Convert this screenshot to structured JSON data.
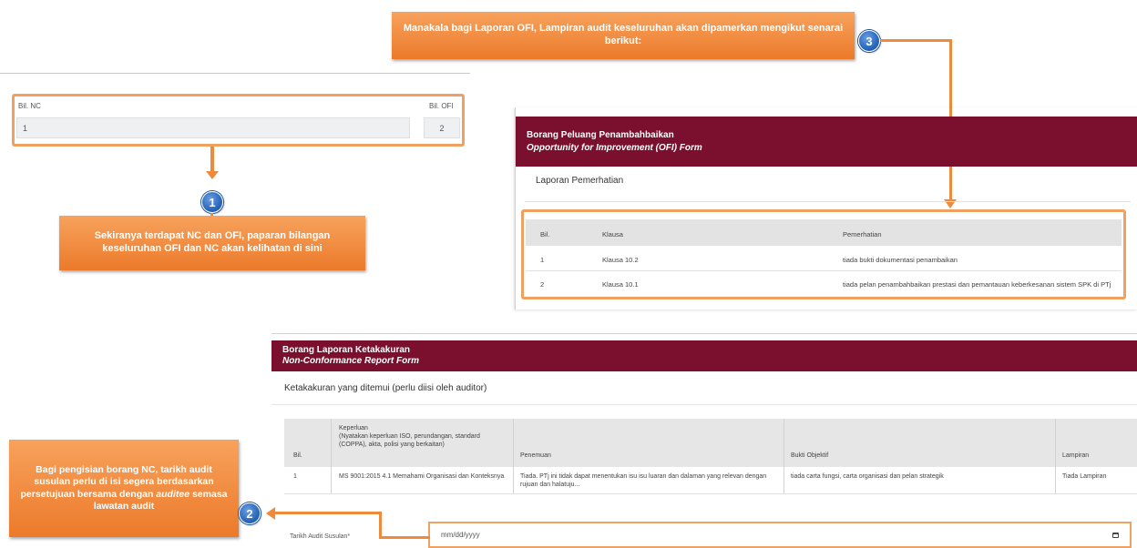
{
  "panel_counts": {
    "nc_label": "Bil. NC",
    "ofi_label": "Bil. OFI",
    "nc_value": "1",
    "ofi_value": "2"
  },
  "callouts": {
    "c1_text": "Sekiranya terdapat NC dan OFI, paparan bilangan keseluruhan OFI dan NC akan kelihatan di sini",
    "c1_number": "1",
    "c2_text_before": "Bagi pengisian borang NC, tarikh audit susulan perlu di isi segera berdasarkan persetujuan bersama dengan ",
    "c2_text_italic": "auditee",
    "c2_text_after": " semasa lawatan audit",
    "c2_number": "2",
    "c3_text": "Manakala bagi Laporan OFI, Lampiran audit keseluruhan akan dipamerkan mengikut senarai berikut:",
    "c3_number": "3"
  },
  "ofi_form": {
    "title": "Borang Peluang Penambahbaikan",
    "subtitle": "Opportunity for Improvement (OFI) Form",
    "section": "Laporan Pemerhatian",
    "headers": [
      "Bil.",
      "Klausa",
      "Pemerhatian"
    ],
    "rows": [
      [
        "1",
        "Klausa 10.2",
        "tiada bukti dokumentasi penambaikan"
      ],
      [
        "2",
        "Klausa 10.1",
        "tiada pelan penambahbaikan prestasi dan pemantauan keberkesanan sistem SPK di PTj"
      ]
    ]
  },
  "nc_form": {
    "title": "Borang Laporan Ketakakuran",
    "subtitle": "Non-Conformance Report Form",
    "section": "Ketakakuran yang ditemui (perlu diisi oleh auditor)",
    "h_bil": "Bil.",
    "h_keperluan_1": "Keperluan",
    "h_keperluan_2": "(Nyatakan keperluan ISO, perundangan, standard (COPPA), akta, polisi yang berkaitan)",
    "h_penemuan": "Penemuan",
    "h_bukti": "Bukti Objektif",
    "h_lampiran": "Lampiran",
    "r_bil": "1",
    "r_keperluan": "MS 9001:2015 4.1 Memahami Organisasi dan Konteksnya",
    "r_penemuan": "Tiada. PTj ini tidak dapat menentukan isu isu luaran dan dalaman yang relevan dengan rujuan dan halatuju...",
    "r_bukti": "tiada carta fungsi, carta organisasi dan pelan strategik",
    "r_lampiran": "Tiada Lampiran",
    "date_label": "Tarikh Audit Susulan*",
    "date_placeholder": "mm/dd/yyyy"
  },
  "colors": {
    "accent_orange": "#ee8a3c",
    "maroon": "#7a0f2e",
    "badge_blue": "#1f5fb7"
  }
}
